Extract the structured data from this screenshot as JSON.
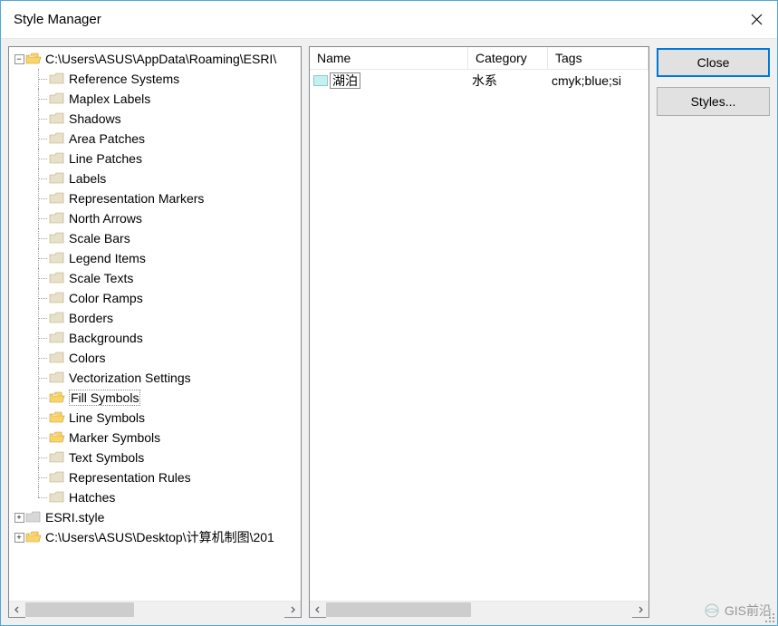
{
  "window": {
    "title": "Style Manager"
  },
  "tree": {
    "root1": {
      "label": "C:\\Users\\ASUS\\AppData\\Roaming\\ESRI\\",
      "expanded": true
    },
    "children": [
      {
        "label": "Reference Systems",
        "type": "closed"
      },
      {
        "label": "Maplex Labels",
        "type": "closed"
      },
      {
        "label": "Shadows",
        "type": "closed"
      },
      {
        "label": "Area Patches",
        "type": "closed"
      },
      {
        "label": "Line Patches",
        "type": "closed"
      },
      {
        "label": "Labels",
        "type": "closed"
      },
      {
        "label": "Representation Markers",
        "type": "closed"
      },
      {
        "label": "North Arrows",
        "type": "closed"
      },
      {
        "label": "Scale Bars",
        "type": "closed"
      },
      {
        "label": "Legend Items",
        "type": "closed"
      },
      {
        "label": "Scale Texts",
        "type": "closed"
      },
      {
        "label": "Color Ramps",
        "type": "closed"
      },
      {
        "label": "Borders",
        "type": "closed"
      },
      {
        "label": "Backgrounds",
        "type": "closed"
      },
      {
        "label": "Colors",
        "type": "closed"
      },
      {
        "label": "Vectorization Settings",
        "type": "closed"
      },
      {
        "label": "Fill Symbols",
        "type": "open",
        "selected": true
      },
      {
        "label": "Line Symbols",
        "type": "open"
      },
      {
        "label": "Marker Symbols",
        "type": "open"
      },
      {
        "label": "Text Symbols",
        "type": "closed"
      },
      {
        "label": "Representation Rules",
        "type": "closed"
      },
      {
        "label": "Hatches",
        "type": "closed"
      }
    ],
    "root2": {
      "label": "ESRI.style"
    },
    "root3": {
      "label": "C:\\Users\\ASUS\\Desktop\\计算机制图\\201"
    }
  },
  "list": {
    "headers": {
      "name": "Name",
      "category": "Category",
      "tags": "Tags"
    },
    "rows": [
      {
        "name": "湖泊",
        "category": "水系",
        "tags": "cmyk;blue;si"
      }
    ]
  },
  "buttons": {
    "close": "Close",
    "styles": "Styles..."
  },
  "watermark": "GIS前沿"
}
